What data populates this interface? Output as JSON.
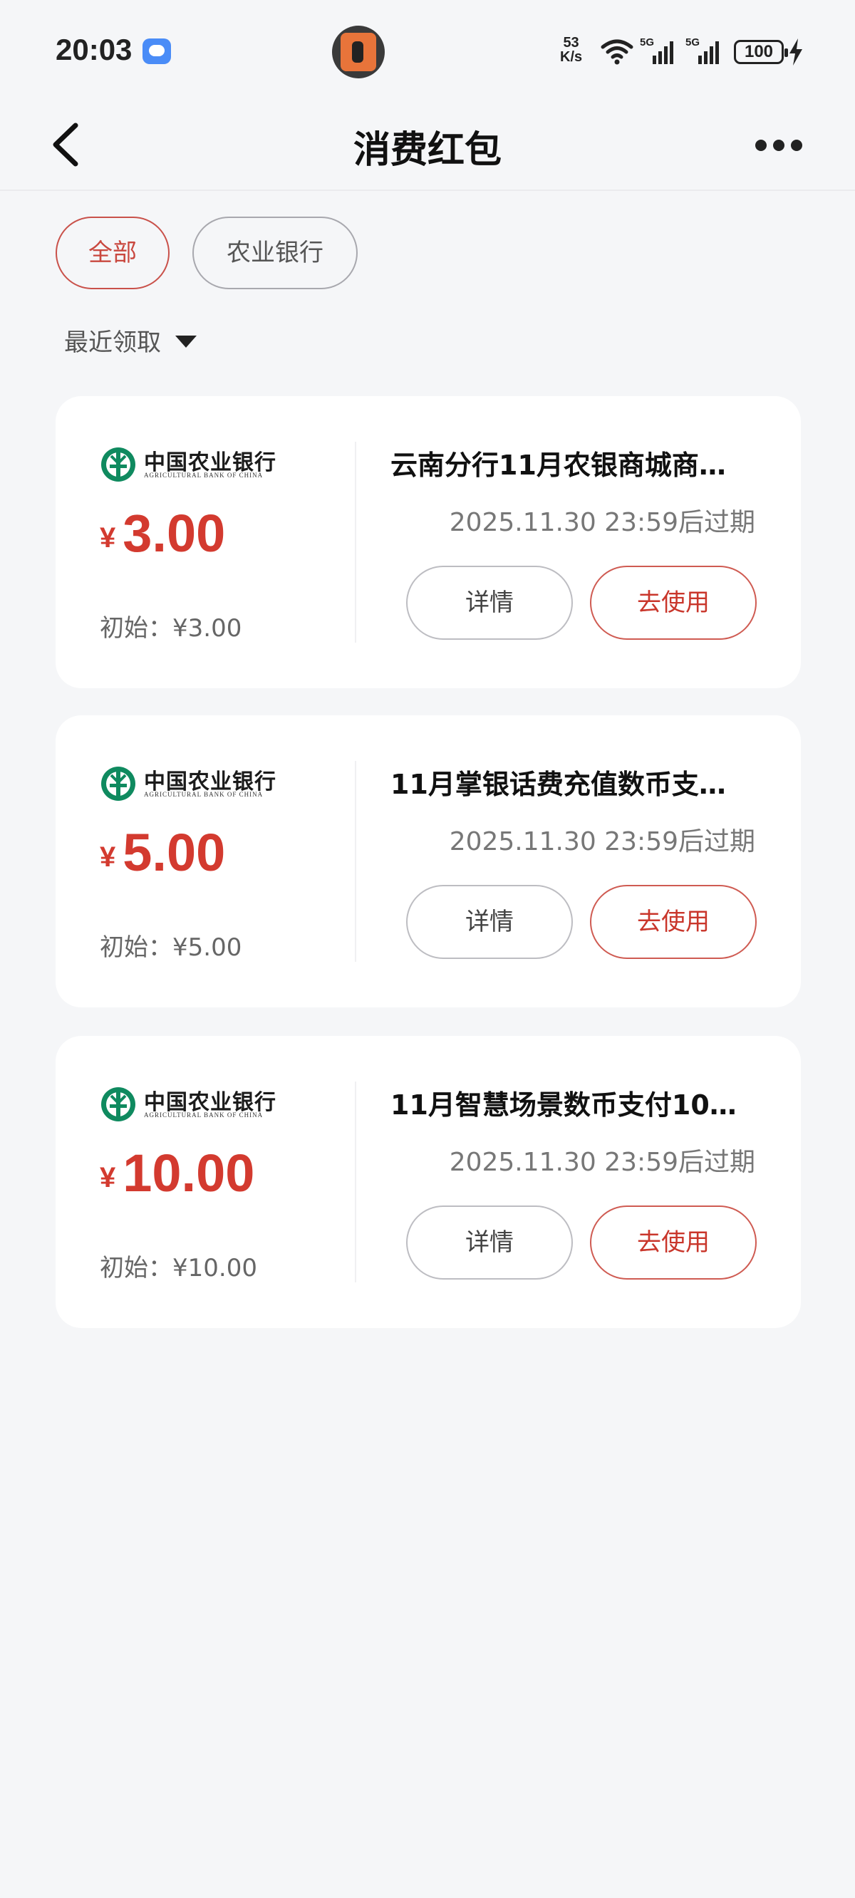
{
  "status_bar": {
    "time": "20:03",
    "net_speed_value": "53",
    "net_speed_unit": "K/s",
    "network_label_1": "5G",
    "network_label_2": "5G",
    "battery": "100"
  },
  "header": {
    "title": "消费红包",
    "back_icon": "chevron-left-icon",
    "more_icon": "more-dots-icon"
  },
  "filters": [
    {
      "label": "全部",
      "selected": true
    },
    {
      "label": "农业银行",
      "selected": false
    }
  ],
  "sort": {
    "label": "最近领取",
    "icon": "caret-down-icon"
  },
  "bank": {
    "name_cn": "中国农业银行",
    "name_en": "AGRICULTURAL BANK OF CHINA",
    "color": "#0f8a5f"
  },
  "colors": {
    "accent": "#d33a2f",
    "background": "#f5f6f8"
  },
  "cards": [
    {
      "currency": "¥",
      "amount": "3.00",
      "original": "初始：¥3.00",
      "title": "云南分行11月农银商城商…",
      "expiry": "2025.11.30 23:59后过期",
      "detail_label": "详情",
      "use_label": "去使用"
    },
    {
      "currency": "¥",
      "amount": "5.00",
      "original": "初始：¥5.00",
      "title": "11月掌银话费充值数币支…",
      "expiry": "2025.11.30 23:59后过期",
      "detail_label": "详情",
      "use_label": "去使用"
    },
    {
      "currency": "¥",
      "amount": "10.00",
      "original": "初始：¥10.00",
      "title": "11月智慧场景数币支付10…",
      "expiry": "2025.11.30 23:59后过期",
      "detail_label": "详情",
      "use_label": "去使用"
    }
  ]
}
